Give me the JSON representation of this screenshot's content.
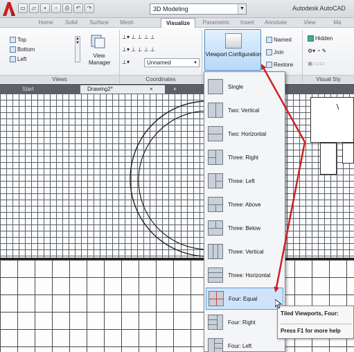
{
  "window": {
    "app_title": "Autodesk AutoCAD",
    "workspace": "3D Modeling",
    "qat_icons": [
      "new-icon",
      "open-icon",
      "save-icon",
      "save-as-icon",
      "plot-icon",
      "undo-icon",
      "redo-icon"
    ]
  },
  "ribbon_tabs": [
    "Home",
    "Solid",
    "Surface",
    "Mesh",
    "Visualize",
    "Parametric",
    "Insert",
    "Annotate",
    "View",
    "Ma"
  ],
  "active_tab": "Visualize",
  "ribbon": {
    "views": {
      "items": [
        "Top",
        "Bottom",
        "Left"
      ],
      "view_manager": "View Manager",
      "title": "Views"
    },
    "coordinates": {
      "ucs_combo": "Unnamed",
      "title": "Coordinates"
    },
    "viewport_config": {
      "label": "Viewport Configuration"
    },
    "model_viewports": {
      "items": [
        "Named",
        "Join",
        "Restore"
      ]
    },
    "visual_styles": {
      "style": "Hidden",
      "title": "Visual Sty"
    }
  },
  "doc_tabs": {
    "start": "Start",
    "drawing": "Drawing2*",
    "close": "×",
    "add": "+"
  },
  "viewport_menu": {
    "items": [
      {
        "label": "Single",
        "icon": "single-viewport-icon"
      },
      {
        "label": "Two: Vertical",
        "icon": "two-vertical-icon"
      },
      {
        "label": "Two: Horizontal",
        "icon": "two-horizontal-icon"
      },
      {
        "label": "Three: Right",
        "icon": "three-right-icon"
      },
      {
        "label": "Three: Left",
        "icon": "three-left-icon"
      },
      {
        "label": "Three: Above",
        "icon": "three-above-icon"
      },
      {
        "label": "Three: Below",
        "icon": "three-below-icon"
      },
      {
        "label": "Three: Vertical",
        "icon": "three-vertical-icon"
      },
      {
        "label": "Three: Horizontal",
        "icon": "three-horizontal-icon"
      },
      {
        "label": "Four: Equal",
        "icon": "four-equal-icon"
      },
      {
        "label": "Four: Right",
        "icon": "four-right-icon"
      },
      {
        "label": "Four: Left",
        "icon": "four-left-icon"
      }
    ],
    "selected": "Four: Equal"
  },
  "tooltip": {
    "title": "Tiled Viewports, Four:",
    "help": "Press F1 for more help"
  },
  "colors": {
    "annotation_arrow": "#cc2222",
    "selection": "#cfe4fb"
  }
}
